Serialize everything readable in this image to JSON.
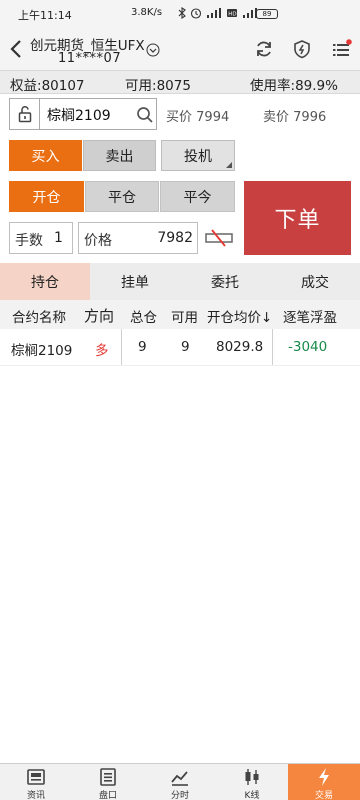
{
  "status_bar": {
    "time": "上午11:14",
    "net_speed": "3.8K/s",
    "battery": "89",
    "icons": [
      "bluetooth-icon",
      "alarm-icon",
      "signal-icon",
      "hd-icon",
      "wifi-icon"
    ]
  },
  "header": {
    "title_line1": "创元期货_恒生UFX",
    "title_line2": "11****07",
    "icons": [
      "back-icon",
      "dropdown-icon",
      "refresh-icon",
      "shield-icon",
      "menu-icon"
    ],
    "badge_color": "#e53935"
  },
  "account": {
    "equity_label": "权益:",
    "equity_value": "80107",
    "available_label": "可用:",
    "available_value": "8075",
    "usage_label": "使用率:",
    "usage_value": "89.9%"
  },
  "order_form": {
    "contract": "棕榈2109",
    "bid_label": "买价",
    "bid_value": "7994",
    "ask_label": "卖价",
    "ask_value": "7996",
    "buy_label": "买入",
    "sell_label": "卖出",
    "speculation_label": "投机",
    "open_label": "开仓",
    "close_label": "平仓",
    "close_today_label": "平今",
    "submit_label": "下单",
    "qty_label": "手数",
    "qty_value": "1",
    "price_label": "价格",
    "price_value": "7982",
    "accent_color": "#ea6e12",
    "submit_color": "#c84040"
  },
  "tabs": [
    {
      "label": "持仓",
      "active": true
    },
    {
      "label": "挂单",
      "active": false
    },
    {
      "label": "委托",
      "active": false
    },
    {
      "label": "成交",
      "active": false
    }
  ],
  "positions": {
    "headers": [
      "合约名称",
      "方向",
      "总仓",
      "可用",
      "开仓均价↓",
      "逐笔浮盈"
    ],
    "rows": [
      {
        "contract": "棕榈2109",
        "direction": "多",
        "total": "9",
        "available": "9",
        "avg_price": "8029.8",
        "pnl": "-3040"
      }
    ],
    "direction_color": "#e53935",
    "pnl_color": "#1a8a4a"
  },
  "bottom_nav": [
    {
      "label": "资讯",
      "icon": "news-icon",
      "active": false
    },
    {
      "label": "盘口",
      "icon": "orderbook-icon",
      "active": false
    },
    {
      "label": "分时",
      "icon": "intraday-icon",
      "active": false
    },
    {
      "label": "K线",
      "icon": "kline-icon",
      "active": false
    },
    {
      "label": "交易",
      "icon": "trade-icon",
      "active": true
    }
  ]
}
